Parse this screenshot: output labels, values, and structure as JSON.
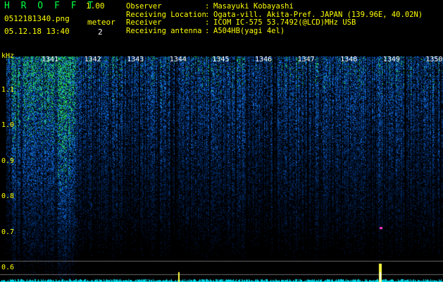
{
  "app": {
    "title": "H R O F F T",
    "version": "1.00"
  },
  "file": {
    "name": "0512181340.png",
    "datetime": "05.12.18 13:40"
  },
  "meteor": {
    "label": "meteor",
    "count": "2"
  },
  "station": [
    {
      "label": "Observer",
      "value": "Masayuki Kobayashi"
    },
    {
      "label": "Receiving Location",
      "value": "Ogata-vill. Akita-Pref. JAPAN (139.96E, 40.02N)"
    },
    {
      "label": "Receiver",
      "value": "ICOM IC-575 53.7492(@LCD)MHz USB"
    },
    {
      "label": "Receiving antenna",
      "value": "A504HB(yagi 4el)"
    }
  ],
  "spectrogram": {
    "y_unit": "kHz",
    "y_ticks": [
      {
        "label": "1.1",
        "value": 1.1
      },
      {
        "label": "1.0",
        "value": 1.0
      },
      {
        "label": "0.9",
        "value": 0.9
      },
      {
        "label": "0.8",
        "value": 0.8
      },
      {
        "label": "0.7",
        "value": 0.7
      },
      {
        "label": "0.6",
        "value": 0.6
      }
    ],
    "time_labels": [
      "1341",
      "1342",
      "1343",
      "1344",
      "1345",
      "1346",
      "1347",
      "1348",
      "1349",
      "1350"
    ],
    "colors": {
      "background": "#000000",
      "noise_low": "#00306e",
      "noise_mid": "#1468d2",
      "noise_high": "#28d25a",
      "hot": "#ff3cc8",
      "label": "#ffff00"
    }
  }
}
